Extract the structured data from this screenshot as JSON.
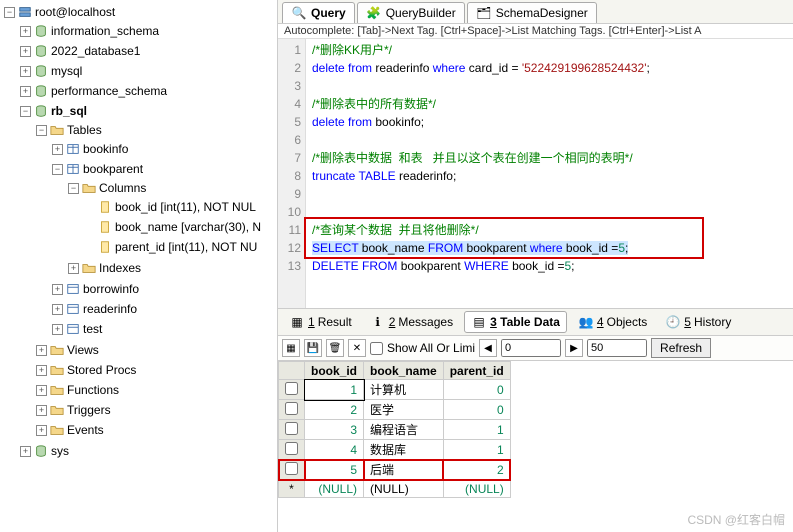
{
  "tree": {
    "root": "root@localhost",
    "dbs": [
      "information_schema",
      "2022_database1",
      "mysql",
      "performance_schema"
    ],
    "rb_sql": "rb_sql",
    "tables_label": "Tables",
    "tables": [
      "bookinfo"
    ],
    "bookparent": "bookparent",
    "columns_label": "Columns",
    "columns": [
      "book_id [int(11), NOT NUL",
      "book_name [varchar(30), N",
      "parent_id [int(11), NOT NU"
    ],
    "indexes_label": "Indexes",
    "other_tables": [
      "borrowinfo",
      "readerinfo",
      "test"
    ],
    "sections": [
      "Views",
      "Stored Procs",
      "Functions",
      "Triggers",
      "Events"
    ],
    "sys": "sys"
  },
  "tabs": {
    "query": "Query",
    "builder": "QueryBuilder",
    "designer": "SchemaDesigner"
  },
  "autocomplete": "Autocomplete: [Tab]->Next Tag. [Ctrl+Space]->List Matching Tags. [Ctrl+Enter]->List A",
  "code": {
    "l1": "/*删除KK用户*/",
    "l2a": "delete",
    "l2b": "from",
    "l2c": " readerinfo ",
    "l2d": "where",
    "l2e": " card_id = ",
    "l2s": "'522429199628524432'",
    "l2f": ";",
    "l4": "/*删除表中的所有数据*/",
    "l5a": "delete",
    "l5b": "from",
    "l5c": " bookinfo;",
    "l7": "/*删除表中数据  和表   并且以这个表在创建一个相同的表明*/",
    "l8a": "truncate",
    "l8b": "TABLE",
    "l8c": " readerinfo;",
    "l11": "/*查询某个数据  并且将他删除*/",
    "l12a": "SELECT",
    "l12b": " book_name ",
    "l12c": "FROM",
    "l12d": " bookparent ",
    "l12e": "where",
    "l12f": " book_id =",
    "l12n": "5",
    "l12g": ";",
    "l13a": "DELETE",
    "l13b": "FROM",
    "l13c": " bookparent ",
    "l13d": "WHERE",
    "l13e": " book_id =",
    "l13n": "5",
    "l13f": ";"
  },
  "results_tabs": {
    "result": "Result",
    "result_n": "1",
    "messages": "Messages",
    "messages_n": "2",
    "tabledata": "Table Data",
    "tabledata_n": "3",
    "objects": "Objects",
    "objects_n": "4",
    "history": "History",
    "history_n": "5"
  },
  "toolbar2": {
    "showall": "Show All Or  Limi",
    "from": "0",
    "to": "50",
    "refresh": "Refresh"
  },
  "table": {
    "headers": [
      "book_id",
      "book_name",
      "parent_id"
    ],
    "rows": [
      {
        "id": "1",
        "name": "计算机",
        "pid": "0"
      },
      {
        "id": "2",
        "name": "医学",
        "pid": "0"
      },
      {
        "id": "3",
        "name": "编程语言",
        "pid": "1"
      },
      {
        "id": "4",
        "name": "数据库",
        "pid": "1"
      },
      {
        "id": "5",
        "name": "后端",
        "pid": "2"
      }
    ],
    "nullrow": {
      "star": "*",
      "n": "(NULL)"
    }
  },
  "watermark": "CSDN @红客白帽"
}
